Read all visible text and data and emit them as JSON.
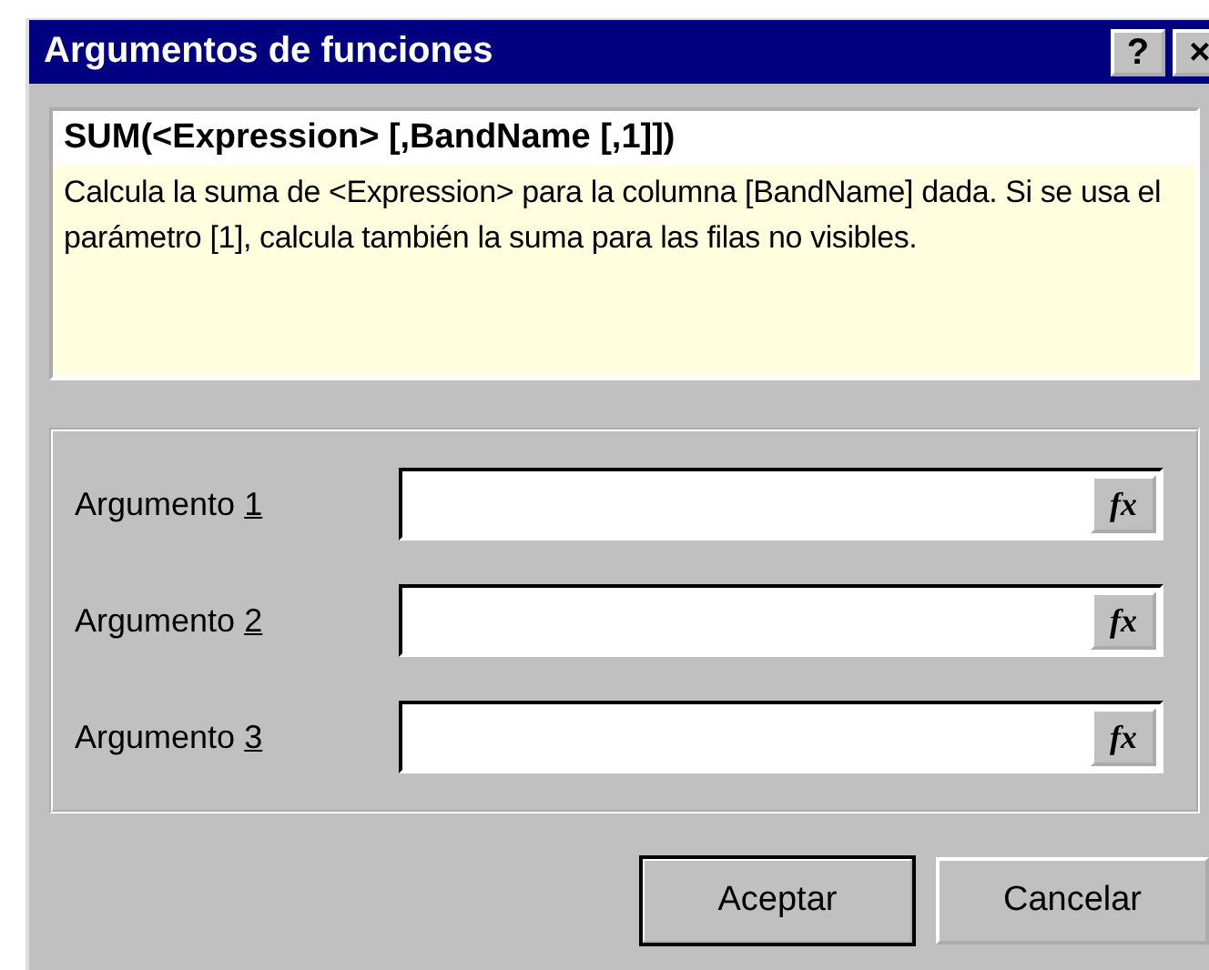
{
  "window": {
    "title": "Argumentos de funciones",
    "title_buttons": [
      "?",
      "×"
    ]
  },
  "function_help": {
    "signature": "SUM(<Expression> [,BandName [,1]])",
    "description": "Calcula la suma de <Expression> para la columna [BandName] dada. Si se usa el parámetro [1], calcula también la suma para las filas no visibles."
  },
  "arguments": [
    {
      "label": "Argumento",
      "access_key": "1",
      "button": "fx"
    },
    {
      "label": "Argumento",
      "access_key": "2",
      "button": "fx"
    },
    {
      "label": "Argumento",
      "access_key": "3",
      "button": "fx"
    }
  ],
  "buttons": [
    {
      "label": "Aceptar",
      "default": true
    },
    {
      "label": "Cancelar",
      "default": false
    }
  ]
}
